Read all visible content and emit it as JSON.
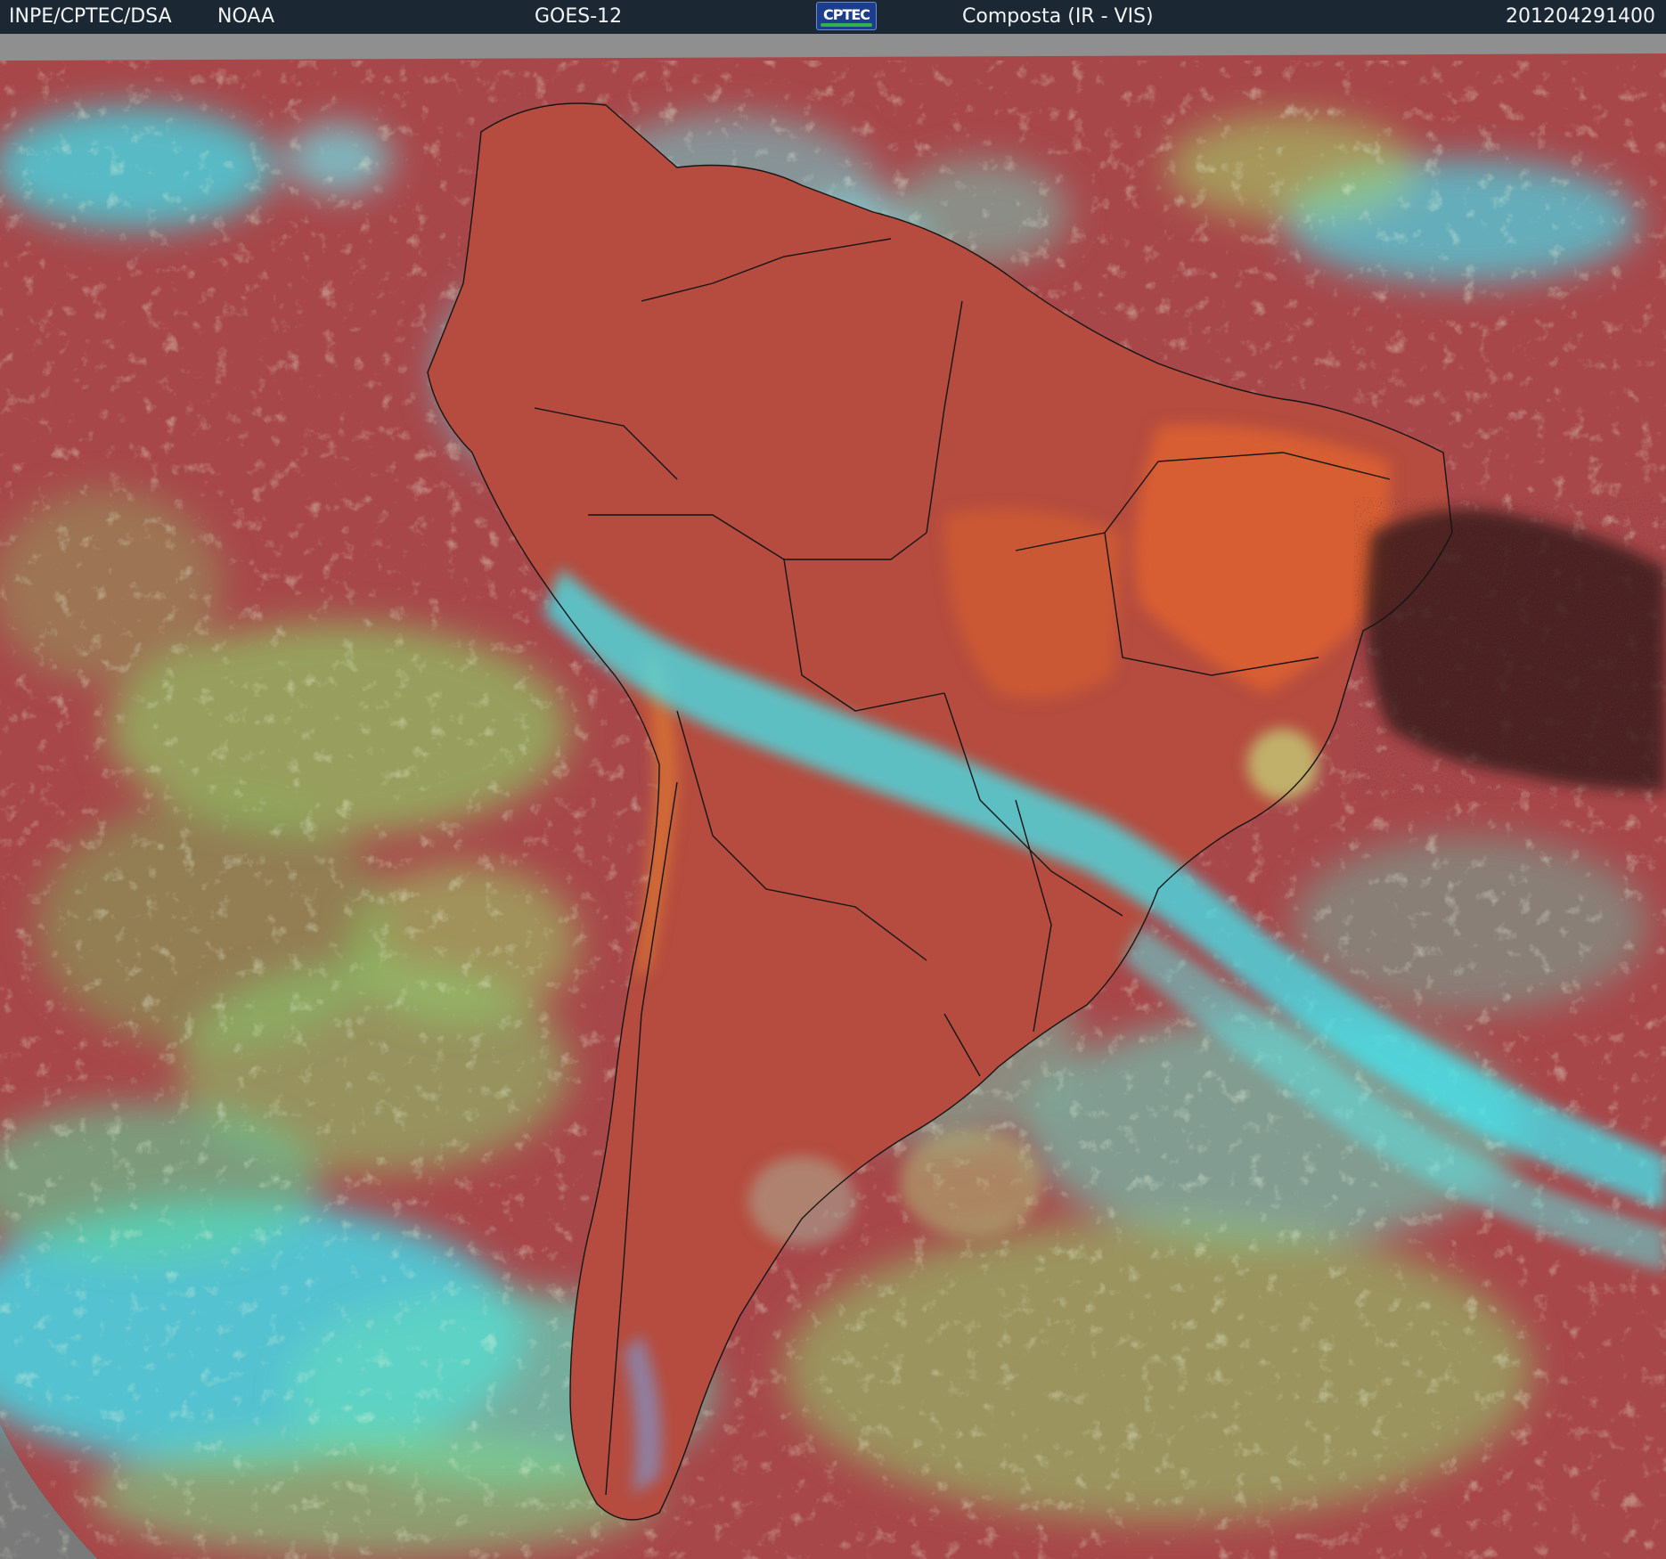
{
  "header": {
    "source_label": "INPE/CPTEC/DSA",
    "agency_label": "NOAA",
    "satellite_label": "GOES-12",
    "logo_text": "CPTEC",
    "product_label": "Composta (IR - VIS)",
    "timestamp": "201204291400"
  },
  "colors": {
    "header_bg": "#1b2733",
    "header_text": "#f2f4f6",
    "clear_ocean": "#a8474a",
    "clear_land": "#c55a3c",
    "dry_land": "#e0632f",
    "high_cloud": "#3fe8ee",
    "mid_cloud": "#7fd86e",
    "low_cloud": "#b8d86c",
    "no_data": "#8f8f8f",
    "coastline": "#151515",
    "logo_bg": "#1c3e8c",
    "logo_band": "#2fb34a"
  },
  "icons": {
    "logo": "cptec-logo-icon"
  }
}
